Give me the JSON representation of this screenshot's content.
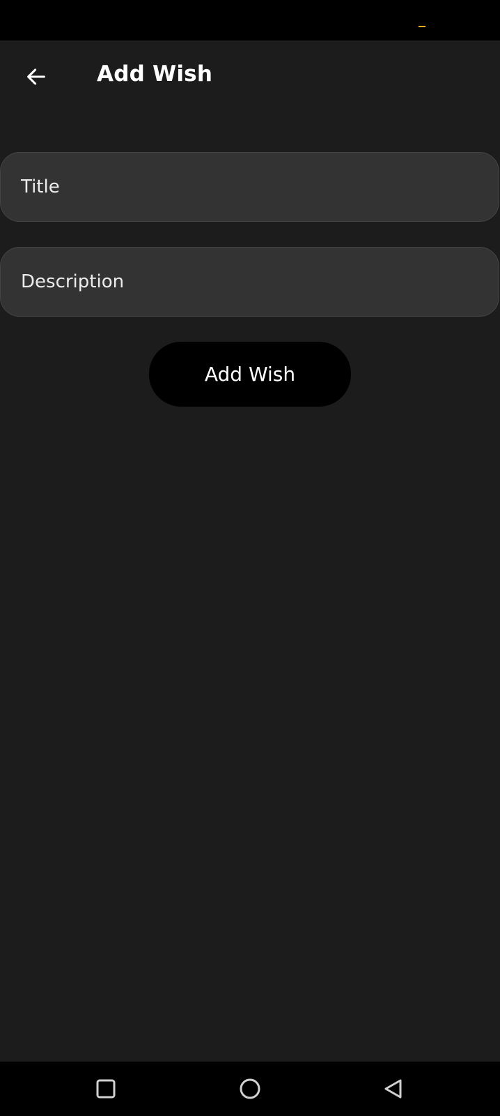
{
  "app": {
    "title": "Add Wish"
  },
  "toolbar": {
    "back_icon": "arrow-back-icon"
  },
  "form": {
    "title_field": {
      "value": "",
      "placeholder": "Title"
    },
    "description_field": {
      "value": "",
      "placeholder": "Description"
    },
    "submit_label": "Add Wish"
  },
  "system_nav": {
    "recents_icon": "square-icon",
    "home_icon": "circle-icon",
    "back_icon": "triangle-back-icon"
  },
  "colors": {
    "background": "#1c1c1c",
    "field_background": "#333333",
    "field_border": "#444444",
    "button_background": "#000000",
    "text": "#ffffff",
    "status_accent": "#f2b01e"
  }
}
